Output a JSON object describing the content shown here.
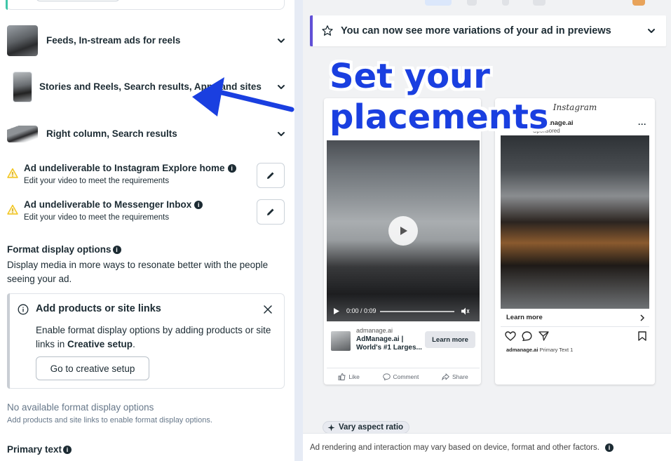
{
  "placements": [
    {
      "label": "Feeds, In-stream ads for reels"
    },
    {
      "label": "Stories and Reels, Search results, Apps and sites"
    },
    {
      "label": "Right column, Search results"
    }
  ],
  "warnings": [
    {
      "title": "Ad undeliverable to Instagram Explore home",
      "subtitle": "Edit your video to meet the requirements"
    },
    {
      "title": "Ad undeliverable to Messenger Inbox",
      "subtitle": "Edit your video to meet the requirements"
    }
  ],
  "format_display": {
    "title": "Format display options",
    "description": "Display media in more ways to resonate better with the people seeing your ad."
  },
  "info_box": {
    "title": "Add products or site links",
    "body_prefix": "Enable format display options by adding products or site links in ",
    "body_bold": "Creative setup",
    "body_suffix": ".",
    "button_label": "Go to creative setup"
  },
  "no_available": {
    "title": "No available format display options",
    "subtitle": "Add products and site links to enable format display options."
  },
  "primary_text": {
    "label": "Primary text"
  },
  "banner": {
    "text": "You can now see more variations of your ad in previews"
  },
  "overlay": {
    "line1": "Set your",
    "line2": "placements"
  },
  "fb_preview": {
    "time": "0:00 / 0:09",
    "domain": "admanage.ai",
    "headline": "AdManage.ai | World's #1 Larges...",
    "cta": "Learn more",
    "like": "Like",
    "comment": "Comment",
    "share": "Share"
  },
  "ig_preview": {
    "logo": "Instagram",
    "username": "admanage.ai",
    "sponsored": "Sponsored",
    "learn_more": "Learn more",
    "caption_user": "admanage.ai",
    "caption_text": "Primary Text 1"
  },
  "vary": {
    "label": "Vary aspect ratio"
  },
  "footer": {
    "text": "Ad rendering and interaction may vary based on device, format and other factors."
  },
  "colors": {
    "accent_blue": "#1a3fe0",
    "banner_accent": "#6150d6",
    "warning": "#f2c418"
  }
}
